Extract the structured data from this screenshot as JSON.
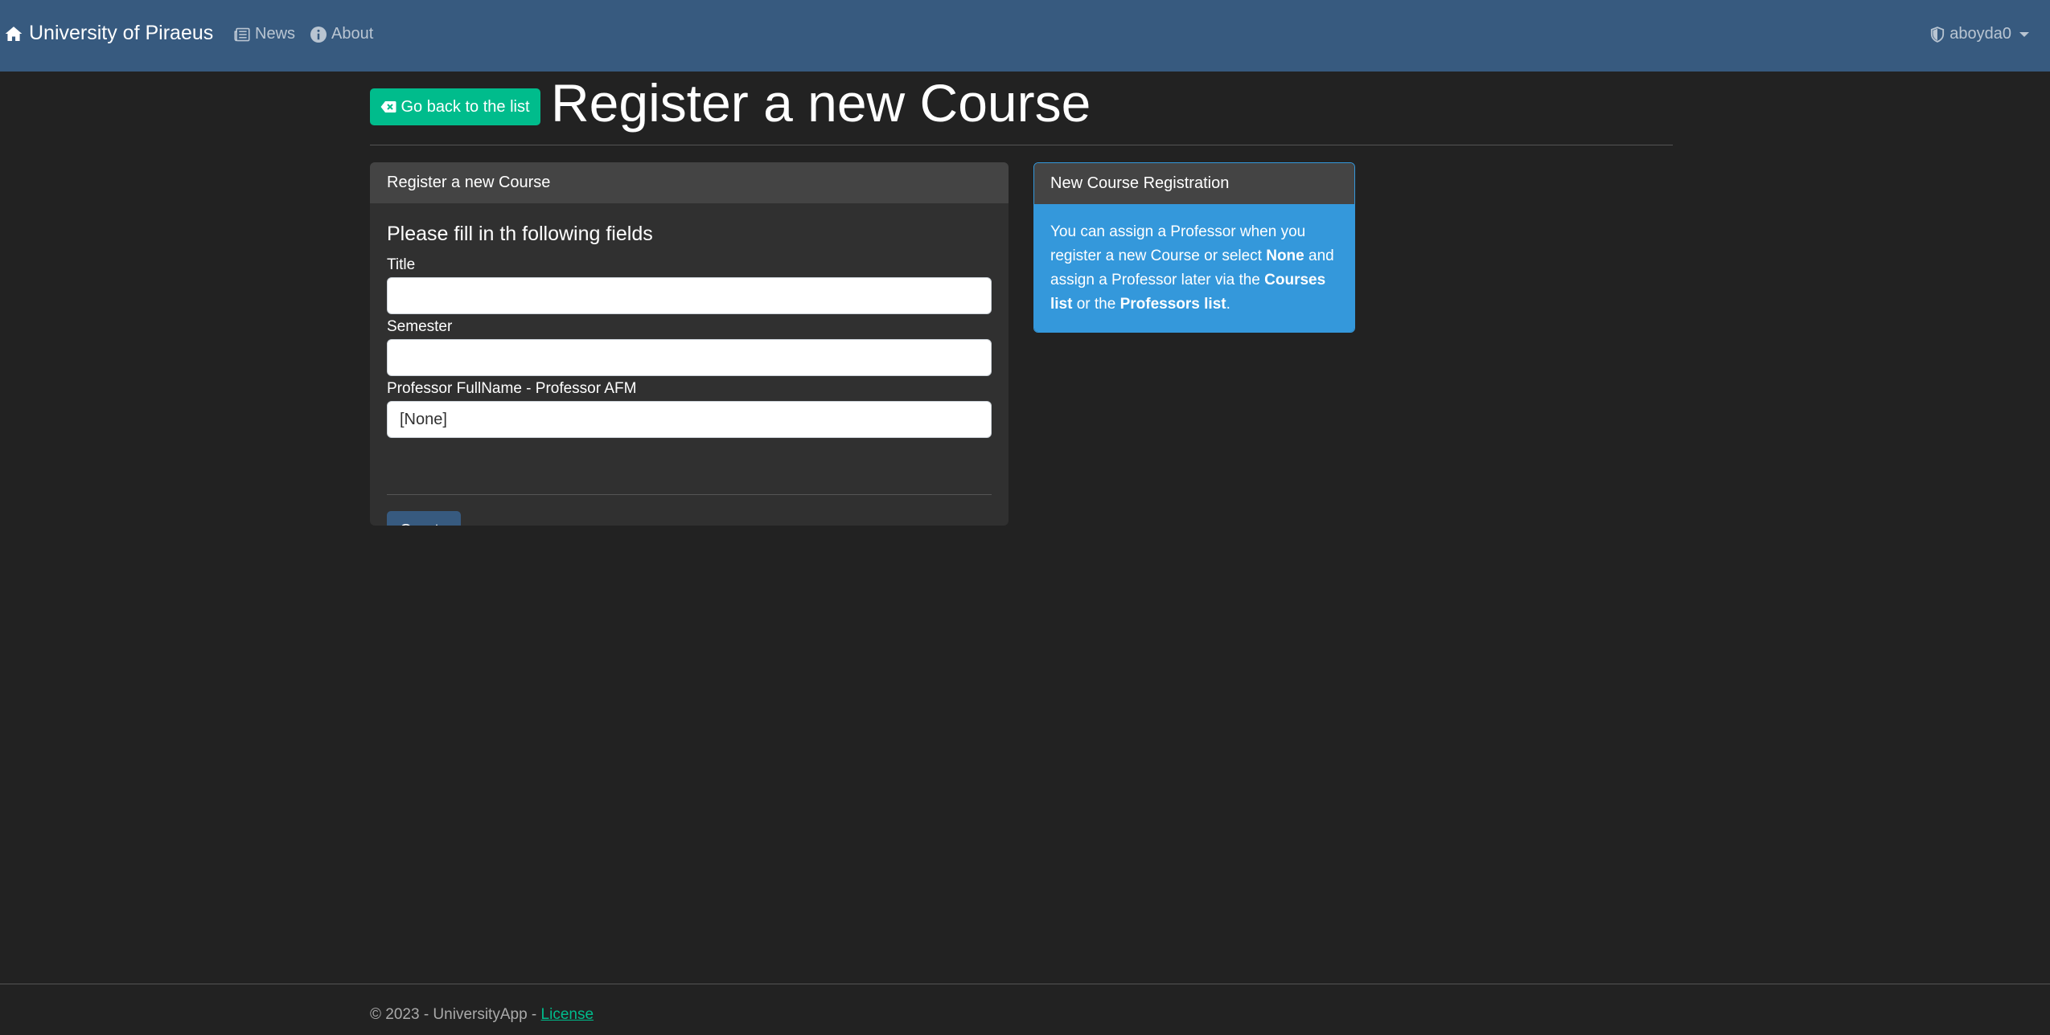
{
  "navbar": {
    "brand": "University of Piraeus",
    "news": "News",
    "about": "About",
    "user": "aboyda0"
  },
  "header": {
    "back_button": "Go back to the list",
    "title": "Register a new Course"
  },
  "form_card": {
    "header": "Register a new Course",
    "intro": "Please fill in th following fields",
    "title_label": "Title",
    "title_value": "",
    "semester_label": "Semester",
    "semester_value": "",
    "professor_label": "Professor FullName - Professor AFM",
    "professor_value": "[None]",
    "create_button": "Create"
  },
  "info_card": {
    "header": "New Course Registration",
    "text_1": "You can assign a Professor when you register a new Course or select ",
    "bold_1": "None",
    "text_2": " and assign a Professor later via the ",
    "bold_2": "Courses list",
    "text_3": " or the ",
    "bold_3": "Professors list",
    "text_4": "."
  },
  "footer": {
    "text": "© 2023 - UniversityApp - ",
    "license": "License"
  },
  "colors": {
    "navbar": "#375a7f",
    "background": "#222222",
    "success": "#00bc8c",
    "info": "#3498db",
    "primary": "#375a7f"
  },
  "icons": [
    "home-icon",
    "newspaper-icon",
    "info-icon",
    "shield-icon",
    "backspace-icon"
  ]
}
